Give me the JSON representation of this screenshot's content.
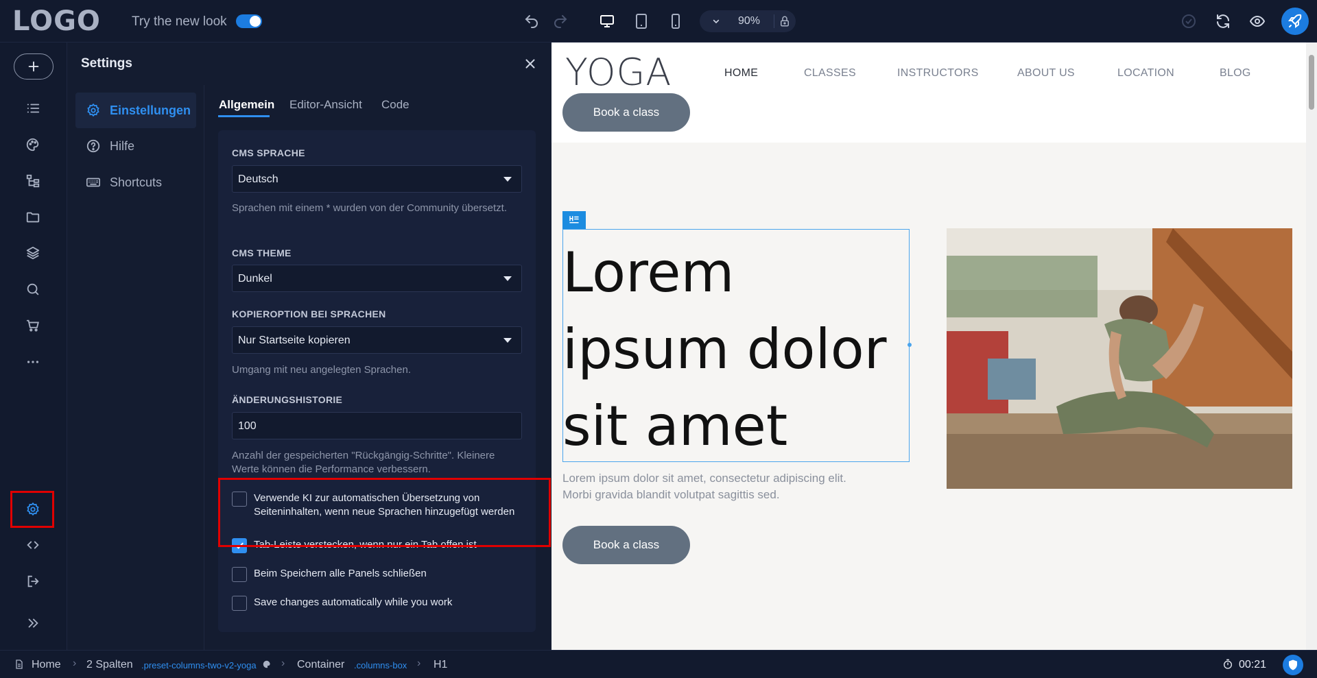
{
  "topbar": {
    "logo": "LOGO",
    "new_look_label": "Try the new look",
    "zoom": "90%"
  },
  "settings": {
    "title": "Settings",
    "nav": [
      {
        "label": "Einstellungen",
        "icon": "gear-icon",
        "active": true
      },
      {
        "label": "Hilfe",
        "icon": "help-circle-icon",
        "active": false
      },
      {
        "label": "Shortcuts",
        "icon": "keyboard-icon",
        "active": false
      }
    ],
    "tabs": [
      {
        "label": "Allgemein",
        "active": true
      },
      {
        "label": "Editor-Ansicht",
        "active": false
      },
      {
        "label": "Code",
        "active": false
      }
    ],
    "fields": {
      "cms_language": {
        "label": "CMS SPRACHE",
        "value": "Deutsch",
        "help": "Sprachen mit einem * wurden von der Community übersetzt."
      },
      "cms_theme": {
        "label": "CMS THEME",
        "value": "Dunkel"
      },
      "copy_option": {
        "label": "KOPIEROPTION BEI SPRACHEN",
        "value": "Nur Startseite kopieren",
        "help": "Umgang mit neu angelegten Sprachen."
      },
      "history": {
        "label": "ÄNDERUNGSHISTORIE",
        "value": "100",
        "help": "Anzahl der gespeicherten \"Rückgängig-Schritte\". Kleinere Werte können die Performance verbessern."
      }
    },
    "checkboxes": [
      {
        "label": "Verwende KI zur automatischen Übersetzung von Seiteninhalten, wenn neue Sprachen hinzugefügt werden",
        "checked": false
      },
      {
        "label": "Tab-Leiste verstecken, wenn nur ein Tab offen ist",
        "checked": true
      },
      {
        "label": "Beim Speichern alle Panels schließen",
        "checked": false
      },
      {
        "label": "Save changes automatically while you work",
        "checked": false
      }
    ]
  },
  "preview": {
    "logo": "YOGA",
    "nav": [
      "HOME",
      "CLASSES",
      "INSTRUCTORS",
      "ABOUT US",
      "LOCATION",
      "BLOG"
    ],
    "book_label": "Book a class",
    "hero_heading": "Lorem ipsum dolor sit amet",
    "hero_text": "Lorem ipsum dolor sit amet, consectetur adipiscing elit. Morbi gravida blandit volutpat sagittis sed."
  },
  "statusbar": {
    "crumbs": [
      {
        "label": "Home"
      },
      {
        "label": "2 Spalten",
        "class": ".preset-columns-two-v2-yoga"
      },
      {
        "label": "Container",
        "class": ".columns-box"
      },
      {
        "label": "H1"
      }
    ],
    "timer": "00:21"
  },
  "colors": {
    "accent": "#2f8ff0",
    "highlight": "#e00000",
    "button": "#627080"
  }
}
